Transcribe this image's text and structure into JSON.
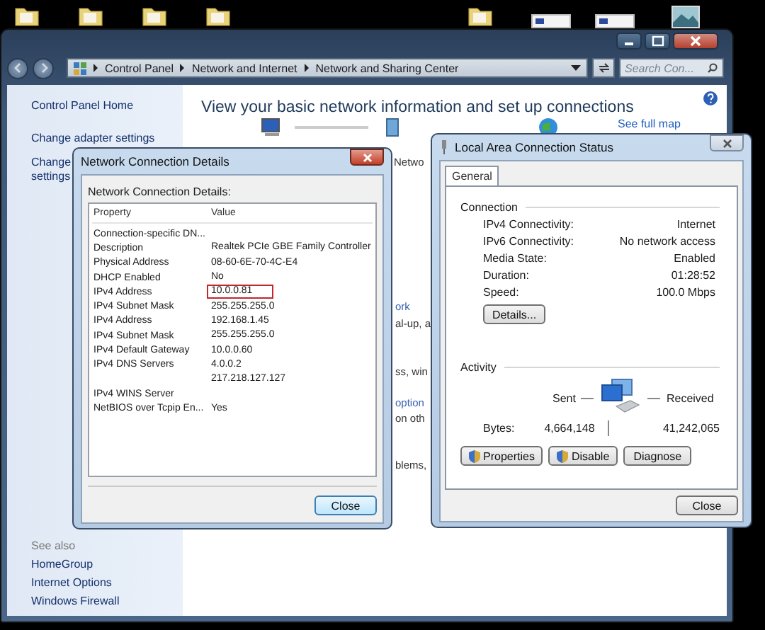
{
  "explorer": {
    "breadcrumbs": [
      "Control Panel",
      "Network and Internet",
      "Network and Sharing Center"
    ],
    "search": {
      "placeholder": "Search Con..."
    },
    "sidebar": {
      "items": [
        "Control Panel Home",
        "Change adapter settings"
      ],
      "partial_items": [
        "Change",
        "settings"
      ],
      "see_also": {
        "title": "See also",
        "items": [
          "HomeGroup",
          "Internet Options",
          "Windows Firewall"
        ]
      }
    },
    "main": {
      "heading": "View your basic network information and set up connections",
      "see_full_map": "See full map",
      "fragments": [
        {
          "text": "Netwo",
          "kind": "text"
        },
        {
          "text": "ork",
          "kind": "link"
        },
        {
          "text": "al-up, a",
          "kind": "text"
        },
        {
          "text": "ss, win",
          "kind": "text"
        },
        {
          "text": "option",
          "kind": "link"
        },
        {
          "text": "on oth",
          "kind": "text"
        },
        {
          "text": "blems,",
          "kind": "text"
        }
      ]
    }
  },
  "details_dialog": {
    "title": "Network Connection Details",
    "caption": "Network Connection Details:",
    "columns": [
      "Property",
      "Value"
    ],
    "rows": [
      {
        "property": "Connection-specific DN...",
        "highlighted": false
      },
      {
        "property": "Description",
        "value": "Realtek PCIe GBE Family Controller",
        "highlighted": false
      },
      {
        "property": "Physical Address",
        "value": "08-60-6E-70-4C-E4",
        "highlighted": false
      },
      {
        "property": "DHCP Enabled",
        "value": "No",
        "highlighted": false
      },
      {
        "property": "IPv4 Address",
        "value": "10.0.0.81",
        "highlighted": true
      },
      {
        "property": "IPv4 Subnet Mask",
        "value": "255.255.255.0",
        "highlighted": false
      },
      {
        "property": "IPv4 Address",
        "value": "192.168.1.45",
        "highlighted": false
      },
      {
        "property": "IPv4 Subnet Mask",
        "value": "255.255.255.0",
        "highlighted": false
      },
      {
        "property": "IPv4 Default Gateway",
        "value": "10.0.0.60",
        "highlighted": false
      },
      {
        "property": "IPv4 DNS Servers",
        "value": "4.0.0.2",
        "highlighted": false
      },
      {
        "value": "217.218.127.127",
        "highlighted": false
      },
      {
        "property": "IPv4 WINS Server",
        "highlighted": false
      },
      {
        "property": "NetBIOS over Tcpip En...",
        "value": "Yes",
        "highlighted": false
      }
    ],
    "close": "Close"
  },
  "status_dialog": {
    "title": "Local Area Connection Status",
    "tabs": [
      {
        "label": "General",
        "selected": true
      }
    ],
    "connection": {
      "title": "Connection",
      "rows": [
        {
          "label": "IPv4 Connectivity:",
          "value": "Internet"
        },
        {
          "label": "IPv6 Connectivity:",
          "value": "No network access"
        },
        {
          "label": "Media State:",
          "value": "Enabled"
        },
        {
          "label": "Duration:",
          "value": "01:28:52"
        },
        {
          "label": "Speed:",
          "value": "100.0 Mbps"
        }
      ],
      "details_button": "Details..."
    },
    "activity": {
      "title": "Activity",
      "sent_label": "Sent",
      "received_label": "Received",
      "bytes_label": "Bytes:",
      "sent": "4,664,148",
      "received": "41,242,065"
    },
    "buttons": [
      {
        "label": "Properties",
        "kind": "shield"
      },
      {
        "label": "Disable",
        "kind": "shield"
      },
      {
        "label": "Diagnose",
        "kind": "plain"
      }
    ],
    "close": "Close"
  }
}
